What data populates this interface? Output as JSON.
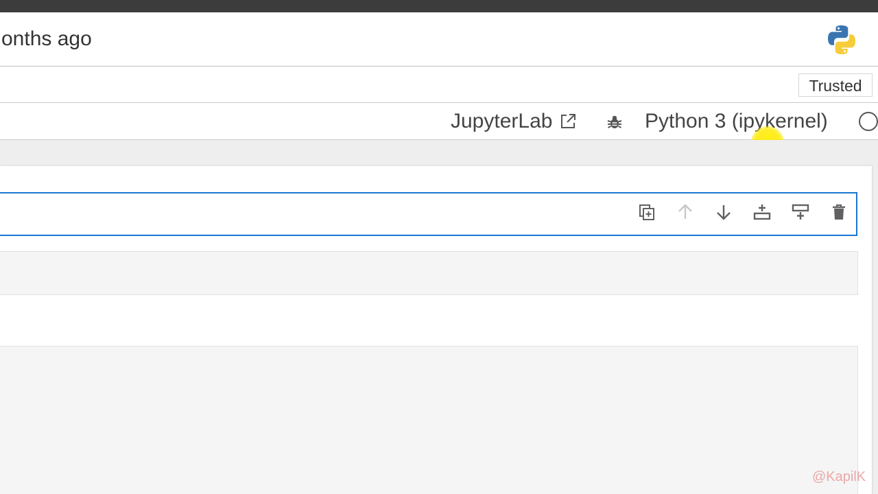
{
  "header": {
    "title_fragment": "onths ago"
  },
  "toolbar": {
    "trusted_label": "Trusted"
  },
  "kernel_bar": {
    "jupyterlab_label": "JupyterLab",
    "kernel_name": "Python 3 (ipykernel)"
  },
  "cell_toolbar": {
    "buttons": [
      "duplicate-cell",
      "move-cell-up",
      "move-cell-down",
      "insert-cell-above",
      "insert-cell-below",
      "delete-cell"
    ]
  },
  "watermark": {
    "text": "@KapilK"
  },
  "colors": {
    "active_cell_border": "#1976d2",
    "top_bar": "#3c3c3c",
    "cursor_highlight": "#ffeb00"
  }
}
